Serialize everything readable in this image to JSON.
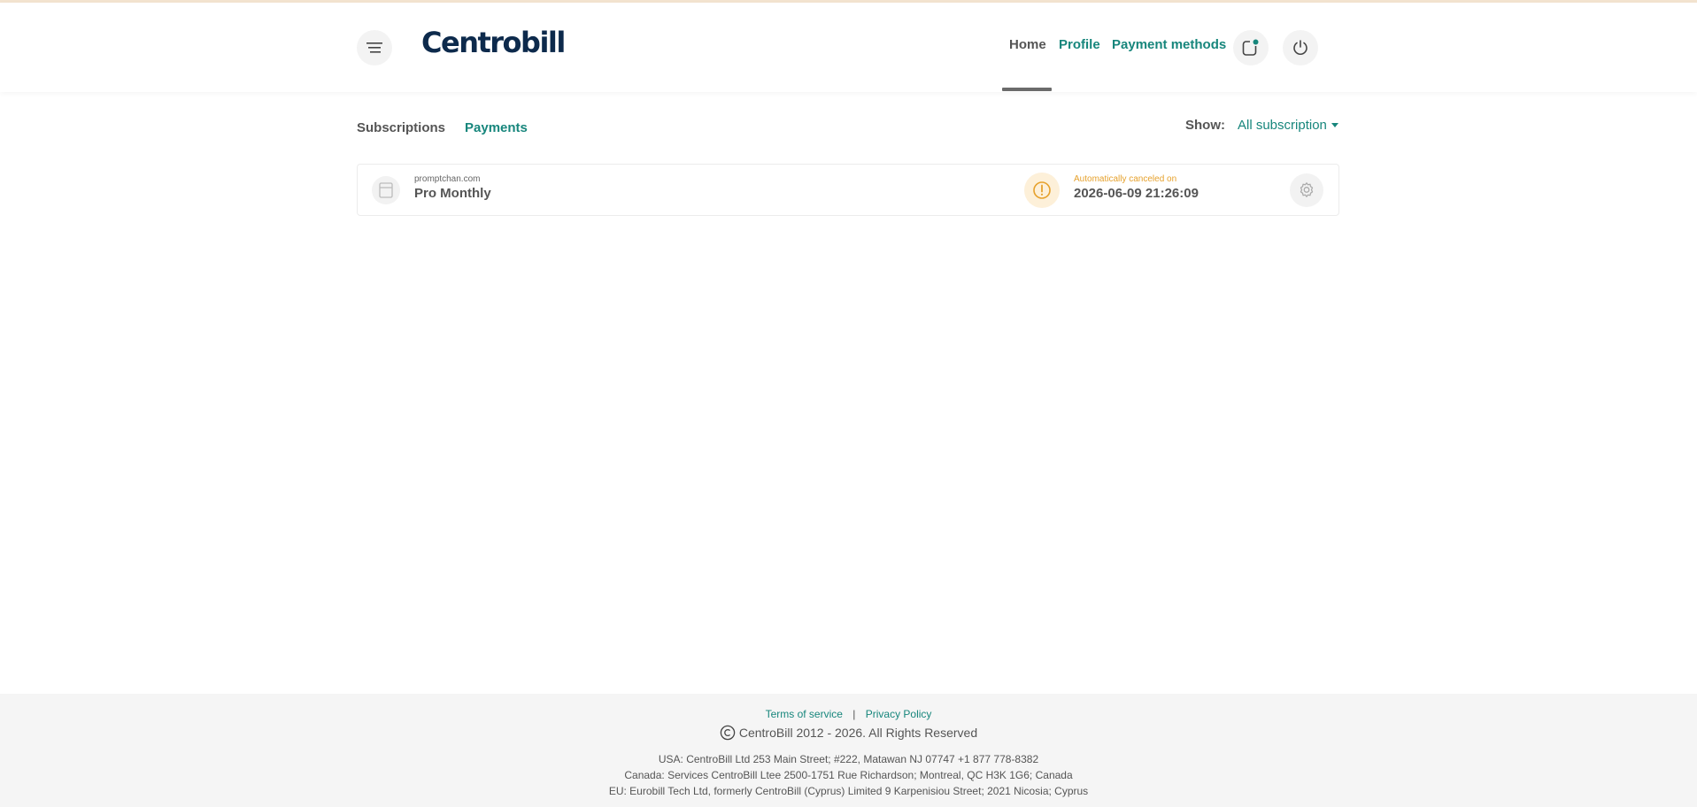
{
  "header": {
    "logo": "Centrobill",
    "nav": {
      "home": "Home",
      "profile": "Profile",
      "payment_methods": "Payment methods"
    }
  },
  "tabs": {
    "subscriptions": "Subscriptions",
    "payments": "Payments"
  },
  "filter": {
    "label": "Show:",
    "selected": "All subscription"
  },
  "subscriptions": [
    {
      "merchant": "promptchan.com",
      "plan": "Pro Monthly",
      "status_label": "Automatically canceled on",
      "date": "2026-06-09 21:26:09"
    }
  ],
  "footer": {
    "terms": "Terms of service",
    "separator": "|",
    "privacy": "Privacy Policy",
    "copyright": "CentroBill 2012 - 2026. All Rights Reserved",
    "address_usa": "USA: CentroBill Ltd 253 Main Street; #222, Matawan NJ 07747 +1 877 778-8382",
    "address_canada": "Canada: Services CentroBill Ltee 2500-1751 Rue Richardson; Montreal, QC H3K 1G6; Canada",
    "address_eu": "EU: Eurobill Tech Ltd, formerly CentroBill (Cyprus) Limited 9 Karpenisiou Street; 2021 Nicosia; Cyprus"
  },
  "colors": {
    "accent": "#17867c",
    "logo": "#0d2a4c",
    "warning": "#e6a12c"
  }
}
